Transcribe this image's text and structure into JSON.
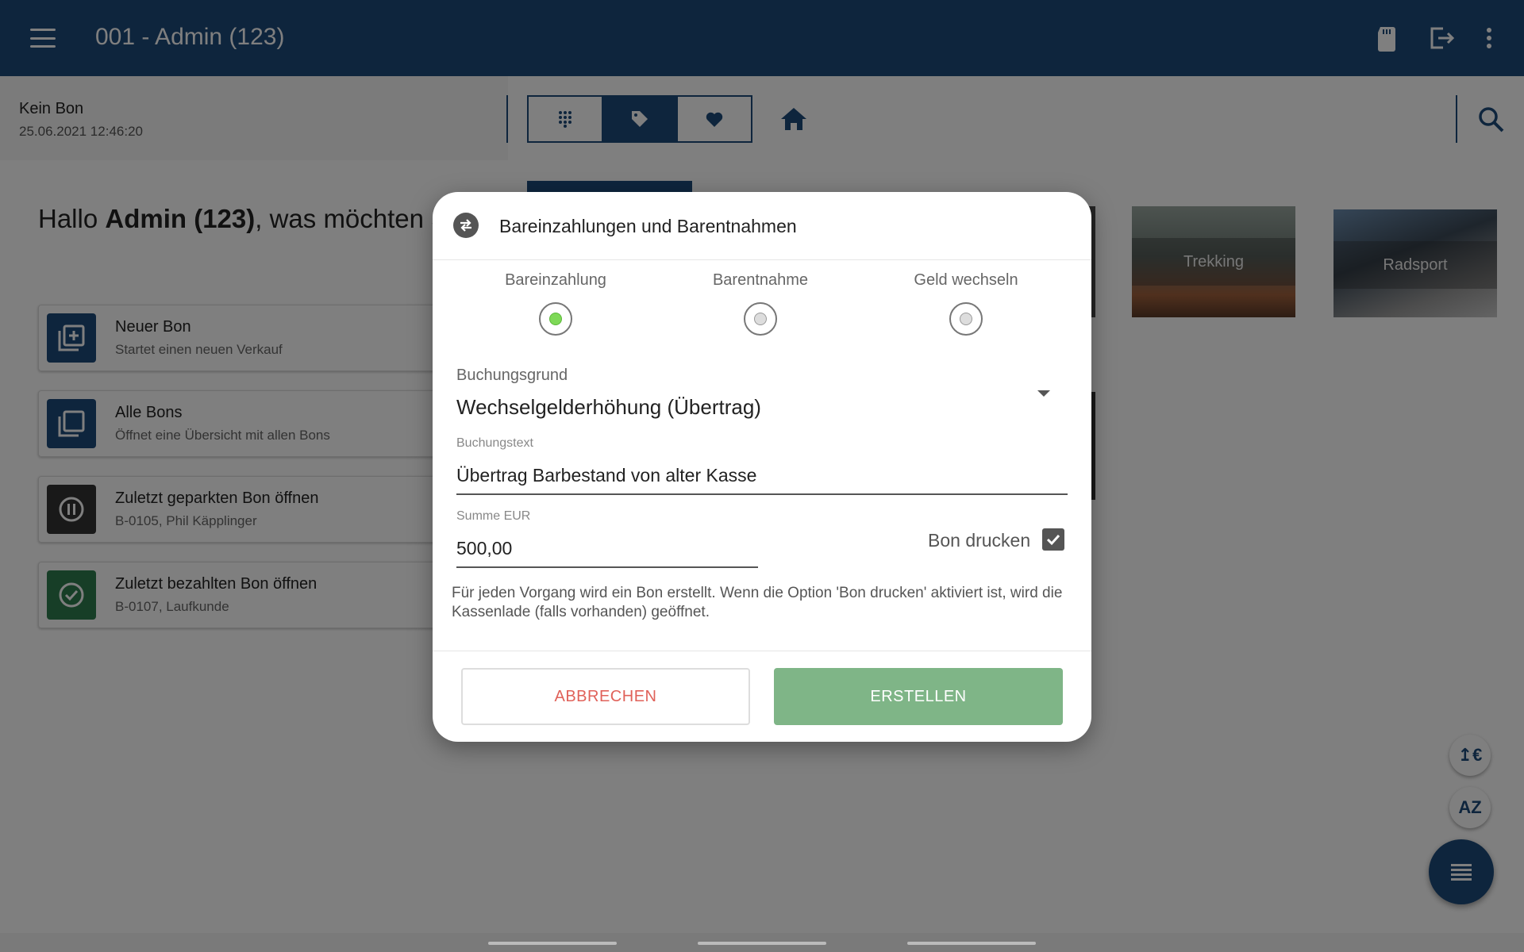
{
  "appbar": {
    "title": "001 - Admin (123)",
    "icons": [
      "menu-icon",
      "sd-card-icon",
      "logout-icon",
      "more-vert-icon"
    ]
  },
  "left": {
    "bon_status": "Kein Bon",
    "timestamp": "25.06.2021 12:46:20",
    "greeting_prefix": "Hallo ",
    "greeting_user": "Admin (123)",
    "greeting_suffix": ", was möchten S tun?",
    "cards": [
      {
        "title": "Neuer Bon",
        "subtitle": "Startet einen neuen Verkauf",
        "color": "#1d4a7a"
      },
      {
        "title": "Alle Bons",
        "subtitle": "Öffnet eine Übersicht mit allen Bons",
        "color": "#1d4a7a"
      },
      {
        "title": "Zuletzt geparkten Bon öffnen",
        "subtitle": "B-0105, Phil Käpplinger",
        "color": "#333333"
      },
      {
        "title": "Zuletzt bezahlten Bon öffnen",
        "subtitle": "B-0107, Laufkunde",
        "color": "#2e7d4f"
      }
    ]
  },
  "right": {
    "tiles": [
      "Trekking",
      "Radsport"
    ]
  },
  "dialog": {
    "title": "Bareinzahlungen und Barentnahmen",
    "options": [
      {
        "label": "Bareinzahlung",
        "selected": true
      },
      {
        "label": "Barentnahme",
        "selected": false
      },
      {
        "label": "Geld wechseln",
        "selected": false
      }
    ],
    "reason_label": "Buchungsgrund",
    "reason_value": "Wechselgelderhöhung (Übertrag)",
    "text_label": "Buchungstext",
    "text_value": "Übertrag Barbestand von alter Kasse",
    "sum_label": "Summe EUR",
    "sum_value": "500,00",
    "print_label": "Bon drucken",
    "print_checked": true,
    "info": "Für jeden Vorgang wird ein Bon erstellt. Wenn die Option 'Bon drucken' aktiviert ist, wird die Kassenlade (falls vorhanden) geöffnet.",
    "cancel_label": "ABBRECHEN",
    "create_label": "ERSTELLEN"
  },
  "colors": {
    "primary": "#1d4a7a",
    "accent_green": "#7fb587",
    "cancel_red": "#e0625a"
  }
}
